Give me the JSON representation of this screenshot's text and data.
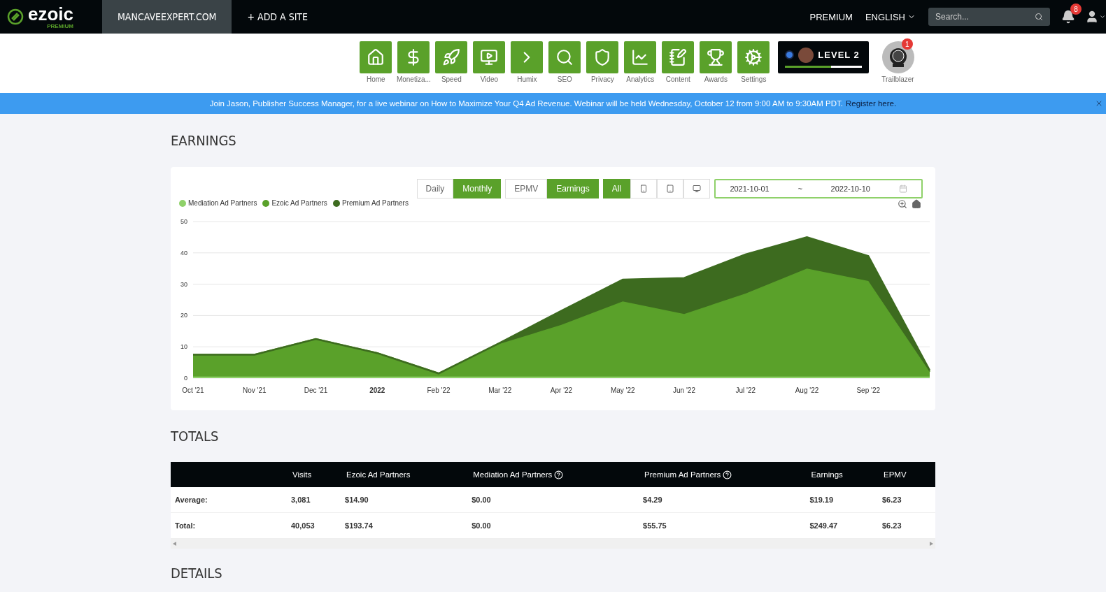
{
  "topbar": {
    "logo": "ezoic",
    "logo_sub": "PREMIUM",
    "site_tabs": [
      {
        "label": "MANCAVEEXPERT.COM",
        "selected": true
      },
      {
        "label": "+ ADD A SITE",
        "selected": false
      }
    ],
    "premium": "PREMIUM",
    "language": "ENGLISH",
    "search": {
      "placeholder": "Search..."
    },
    "notifications": "8"
  },
  "nav": [
    {
      "label": "Home"
    },
    {
      "label": "Monetiza..."
    },
    {
      "label": "Speed"
    },
    {
      "label": "Video"
    },
    {
      "label": "Humix"
    },
    {
      "label": "SEO"
    },
    {
      "label": "Privacy"
    },
    {
      "label": "Analytics"
    },
    {
      "label": "Content"
    },
    {
      "label": "Awards"
    },
    {
      "label": "Settings"
    }
  ],
  "level_badge": {
    "label": "LEVEL 2",
    "level": 0.6
  },
  "trailblazer": {
    "label": "Trailblazer",
    "count": "1"
  },
  "banner": {
    "text": "Join Jason, Publisher Success Manager, for a live webinar on How to Maximize Your Q4 Ad Revenue. Webinar will be held Wednesday, October 12 from 9:00 AM to 9:30AM PDT.",
    "link": "Register here."
  },
  "earnings": {
    "title": "EARNINGS",
    "period_toggle": [
      {
        "label": "Daily",
        "selected": false
      },
      {
        "label": "Monthly",
        "selected": true
      }
    ],
    "metric_toggle": [
      {
        "label": "EPMV",
        "selected": false
      },
      {
        "label": "Earnings",
        "selected": true
      }
    ],
    "device_toggle": [
      {
        "kind": "text",
        "label": "All",
        "selected": true
      },
      {
        "kind": "phone",
        "selected": false
      },
      {
        "kind": "tablet",
        "selected": false
      },
      {
        "kind": "desktop",
        "selected": false
      }
    ],
    "date_from": "2021-10-01",
    "date_sep": "~",
    "date_to": "2022-10-10",
    "chart_data": {
      "type": "area",
      "stacked": true,
      "categories": [
        "Oct '21",
        "Nov '21",
        "Dec '21",
        "2022",
        "Feb '22",
        "Mar '22",
        "Apr '22",
        "May '22",
        "Jun '22",
        "Jul '22",
        "Aug '22",
        "Sep '22",
        null
      ],
      "yticks": [
        0,
        10,
        20,
        30,
        40,
        50
      ],
      "grid": true,
      "ylim": [
        0,
        50
      ],
      "series": [
        {
          "name": "Mediation Ad Partners",
          "color": "#8fd16a",
          "values": [
            0.5,
            0.5,
            0.5,
            0.5,
            0.5,
            0.5,
            0.5,
            0.5,
            0.5,
            0.5,
            0.5,
            0.5,
            0.5
          ]
        },
        {
          "name": "Ezoic Ad Partners",
          "color": "#5aa12a",
          "values": [
            7,
            7,
            12,
            7.5,
            1,
            10.5,
            16.5,
            24,
            20,
            26.5,
            34.5,
            30.5,
            1.5
          ]
        },
        {
          "name": "Premium Ad Partners",
          "color": "#3d6b1f",
          "values": [
            0,
            0,
            0,
            0,
            0,
            0.3,
            4.5,
            7,
            11.5,
            12.5,
            10,
            8,
            0.5
          ]
        }
      ]
    }
  },
  "totals": {
    "title": "TOTALS",
    "columns": [
      {
        "label": "Visits",
        "help": false
      },
      {
        "label": "Ezoic Ad Partners",
        "help": false
      },
      {
        "label": "Mediation Ad Partners",
        "help": true
      },
      {
        "label": "Premium Ad Partners",
        "help": true
      },
      {
        "label": "Earnings",
        "help": false
      },
      {
        "label": "EPMV",
        "help": false
      }
    ],
    "rows": [
      {
        "label": "Average:",
        "cells": [
          "3,081",
          "$14.90",
          "$0.00",
          "$4.29",
          "$19.19",
          "$6.23"
        ]
      },
      {
        "label": "Total:",
        "cells": [
          "40,053",
          "$193.74",
          "$0.00",
          "$55.75",
          "$249.47",
          "$6.23"
        ]
      }
    ]
  },
  "details": {
    "title": "DETAILS"
  }
}
